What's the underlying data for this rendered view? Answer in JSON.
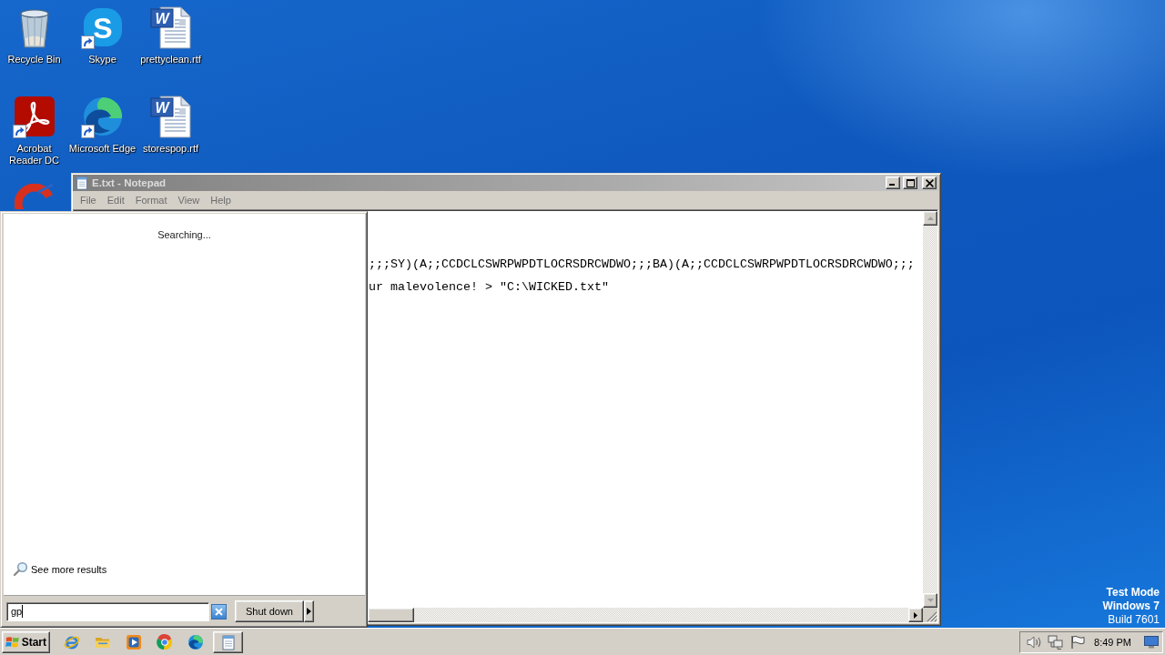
{
  "desktop_icons": [
    {
      "label": "Recycle Bin",
      "kind": "recycle-bin",
      "shortcut": false
    },
    {
      "label": "Skype",
      "kind": "skype",
      "glyph": "S",
      "shortcut": true
    },
    {
      "label": "prettyclean.rtf",
      "kind": "word-document",
      "glyph": "W",
      "shortcut": false
    },
    {
      "label": "Acrobat Reader DC",
      "kind": "acrobat",
      "shortcut": true
    },
    {
      "label": "Microsoft Edge",
      "kind": "edge",
      "shortcut": true
    },
    {
      "label": "storespop.rtf",
      "kind": "word-document",
      "glyph": "W",
      "shortcut": false
    },
    {
      "kind": "cleaner"
    }
  ],
  "notepad": {
    "title": "E.txt - Notepad",
    "menu": [
      "File",
      "Edit",
      "Format",
      "View",
      "Help"
    ],
    "lines": [
      ";;;SY)(A;;CCDCLCSWRPWPDTLOCRSDRCWDWO;;;BA)(A;;CCDCLCSWRPWPDTLOCRSDRCWDWO;;;",
      "ur malevolence! > \"C:\\WICKED.txt\""
    ]
  },
  "start_menu": {
    "status": "Searching...",
    "more_results": "See more results",
    "search": {
      "value": "gp"
    },
    "shutdown": "Shut down"
  },
  "desktop_notice": [
    {
      "text": "Test Mode",
      "bold": true
    },
    {
      "text": "Windows 7",
      "bold": true
    },
    {
      "text": "Build 7601",
      "bold": false
    }
  ],
  "taskbar": {
    "start": "Start",
    "quick_launch": [
      {
        "kind": "internet-explorer"
      },
      {
        "kind": "explorer"
      },
      {
        "kind": "media-player"
      },
      {
        "kind": "chrome"
      },
      {
        "kind": "edge"
      }
    ],
    "tasks": [
      {
        "kind": "notepad"
      }
    ],
    "clock": "8:49 PM"
  }
}
